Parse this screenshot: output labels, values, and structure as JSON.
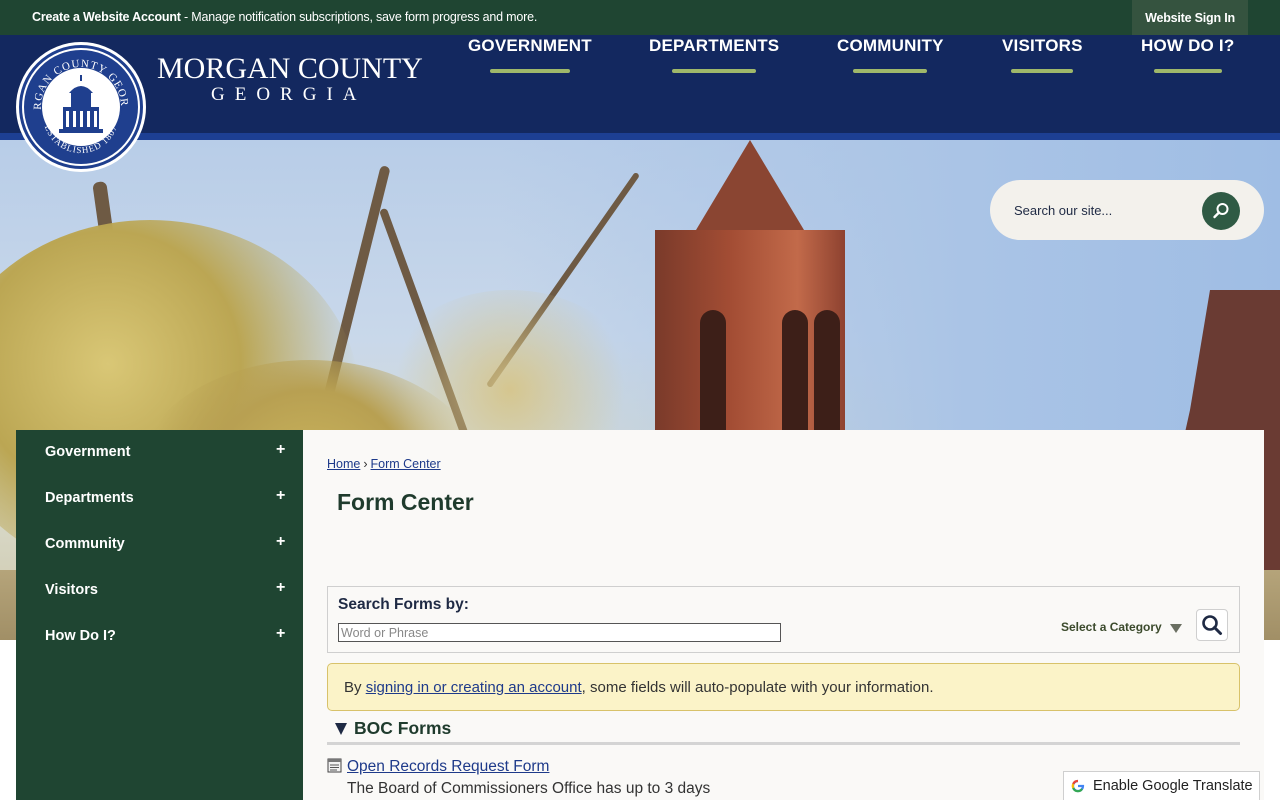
{
  "topbar": {
    "create_bold": "Create a Website Account",
    "create_rest": " - Manage notification subscriptions, save form progress and more.",
    "signin": "Website Sign In"
  },
  "header": {
    "logo_line1": "MORGAN COUNTY",
    "logo_line2": "GEORGIA",
    "seal_top": "MORGAN COUNTY GEORGIA",
    "seal_bottom": "ESTABLISHED 1807",
    "nav": [
      "GOVERNMENT",
      "DEPARTMENTS",
      "COMMUNITY",
      "VISITORS",
      "HOW DO I?"
    ],
    "accent": "#9fb86a",
    "header_bg": "#13285f"
  },
  "search": {
    "placeholder": "Search our site...",
    "icon": "search-icon"
  },
  "sidenav": {
    "items": [
      "Government",
      "Departments",
      "Community",
      "Visitors",
      "How Do I?"
    ],
    "expand_symbol": "+",
    "bg": "#1f4532"
  },
  "breadcrumb": {
    "home": "Home",
    "sep": "›",
    "current": "Form Center"
  },
  "page": {
    "title": "Form Center"
  },
  "form_search": {
    "label": "Search Forms by:",
    "placeholder": "Word or Phrase",
    "category": "Select a Category"
  },
  "notice": {
    "prefix": "By ",
    "link": "signing in or creating an account",
    "suffix": ", some fields will auto-populate with your information."
  },
  "section": {
    "title": "BOC Forms",
    "forms": [
      {
        "title": "Open Records Request Form",
        "description": "The Board of Commissioners Office has up to 3 days"
      }
    ]
  },
  "translate": {
    "label": "Enable Google Translate"
  }
}
